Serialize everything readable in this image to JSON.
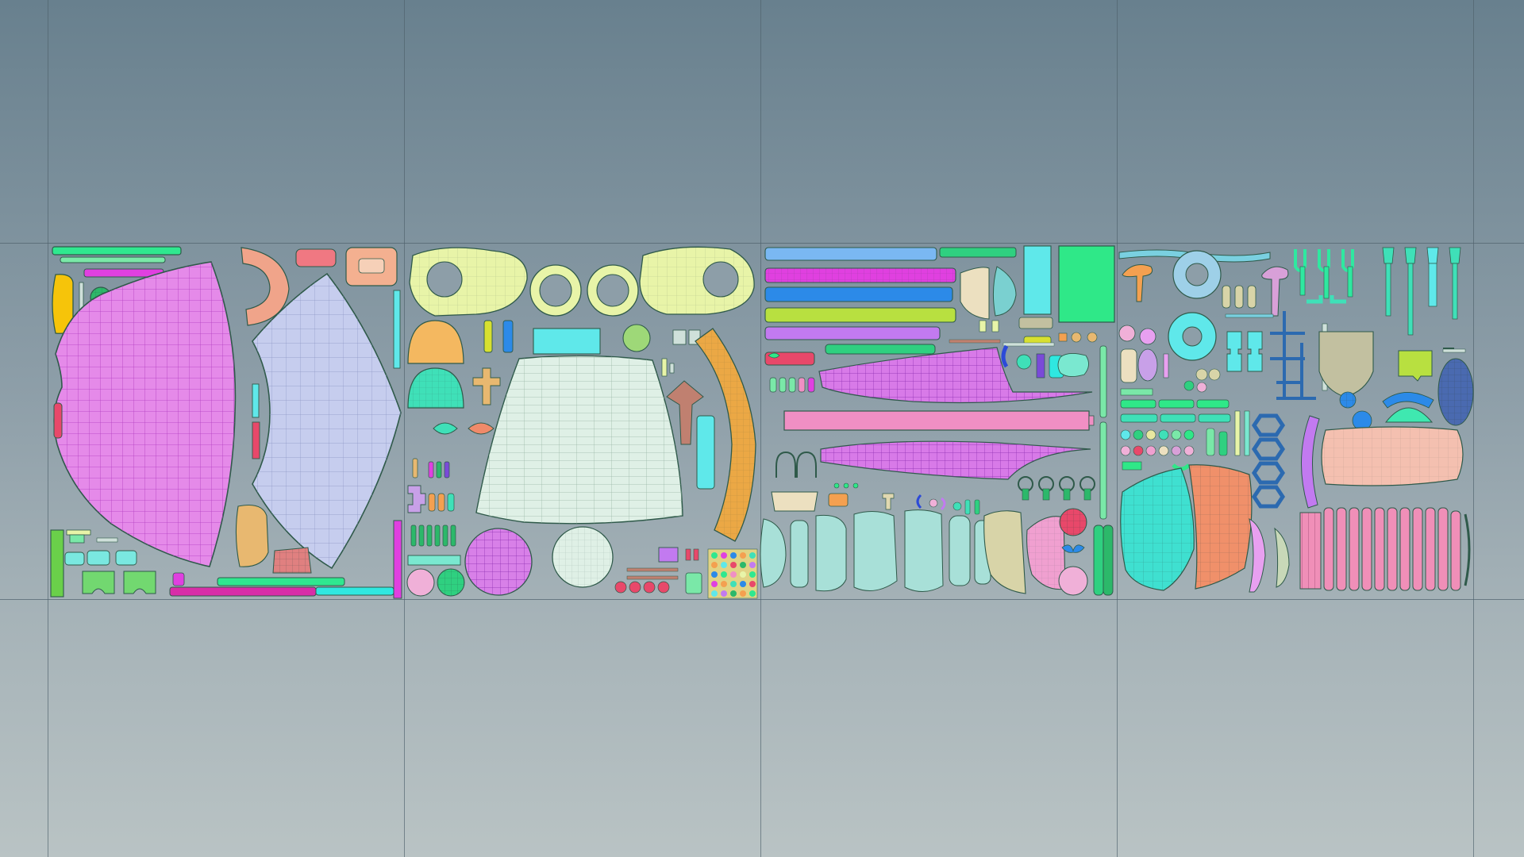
{
  "app": {
    "view": "uv-editor",
    "udim_tiles": 4,
    "udim_rows_visible": 3
  },
  "colors": {
    "background_top": "#68808e",
    "background_bottom": "#b9c3c4",
    "grid_line": "#4f616c",
    "shell_outline": "#2f5a4a",
    "magenta": "#e07ae6",
    "lavender": "#c6cdee",
    "pale_mint": "#dff0e6",
    "cyan": "#5fe8ea",
    "spring_green": "#2fe88f",
    "sky_blue": "#7ab8f2",
    "pink": "#f08fc4",
    "salmon": "#f0a48a",
    "light_yellow": "#e8f4a8",
    "orange": "#f4a050",
    "purple": "#c27af0",
    "teal": "#3fd9b8"
  },
  "uv_shells": {
    "tile_1": [
      "body-panel-magenta",
      "body-panel-lavender",
      "trim-strips",
      "small-parts"
    ],
    "tile_2": [
      "sleeve-rings",
      "skirt-panel",
      "dome-caps",
      "buttons",
      "long-strip-orange"
    ],
    "tile_3": [
      "long-strips",
      "wing-panels",
      "cylinder-shells",
      "fan-pieces"
    ],
    "tile_4": [
      "rings-donut",
      "mushroom-caps",
      "chain-links",
      "arc-panels",
      "stripe-columns"
    ]
  }
}
